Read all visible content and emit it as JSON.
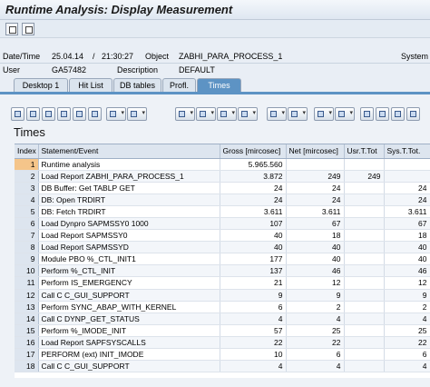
{
  "window": {
    "title": "Runtime Analysis: Display Measurement"
  },
  "header": {
    "date_label": "Date/Time",
    "date_value": "25.04.14",
    "sep": "/",
    "time_value": "21:30:27",
    "object_label": "Object",
    "object_value": "ZABHI_PARA_PROCESS_1",
    "system_label": "System",
    "user_label": "User",
    "user_value": "GA57482",
    "description_label": "Description",
    "description_value": "DEFAULT"
  },
  "tabs": [
    {
      "label": "Desktop 1"
    },
    {
      "label": "Hit List"
    },
    {
      "label": "DB tables"
    },
    {
      "label": "Profl."
    },
    {
      "label": "Times"
    }
  ],
  "active_tab": "Times",
  "section_heading": "Times",
  "table": {
    "columns": [
      "Index",
      "Statement/Event",
      "Gross [mircosec]",
      "Net [mircosec]",
      "Usr.T.Tot",
      "Sys.T.Tot."
    ],
    "rows": [
      [
        "1",
        "Runtime analysis",
        "5.965.560",
        "",
        "",
        ""
      ],
      [
        "2",
        "Load Report ZABHI_PARA_PROCESS_1",
        "3.872",
        "249",
        "249",
        ""
      ],
      [
        "3",
        "DB Buffer: Get TABLP GET",
        "24",
        "24",
        "",
        "24"
      ],
      [
        "4",
        "DB: Open TRDIRT",
        "24",
        "24",
        "",
        "24"
      ],
      [
        "5",
        "DB: Fetch TRDIRT",
        "3.611",
        "3.611",
        "",
        "3.611"
      ],
      [
        "6",
        "Load Dynpro SAPMSSY0 1000",
        "107",
        "67",
        "",
        "67"
      ],
      [
        "7",
        "Load Report SAPMSSY0",
        "40",
        "18",
        "",
        "18"
      ],
      [
        "8",
        "Load Report SAPMSSYD",
        "40",
        "40",
        "",
        "40"
      ],
      [
        "9",
        "Module PBO %_CTL_INIT1",
        "177",
        "40",
        "",
        "40"
      ],
      [
        "10",
        "Perform %_CTL_INIT",
        "137",
        "46",
        "",
        "46"
      ],
      [
        "11",
        "Perform IS_EMERGENCY",
        "21",
        "12",
        "",
        "12"
      ],
      [
        "12",
        "Call C C_GUI_SUPPORT",
        "9",
        "9",
        "",
        "9"
      ],
      [
        "13",
        "Perform SYNC_ABAP_WITH_KERNEL",
        "6",
        "2",
        "",
        "2"
      ],
      [
        "14",
        "Call C DYNP_GET_STATUS",
        "4",
        "4",
        "",
        "4"
      ],
      [
        "15",
        "Perform %_IMODE_INIT",
        "57",
        "25",
        "",
        "25"
      ],
      [
        "16",
        "Load Report SAPFSYSCALLS",
        "22",
        "22",
        "",
        "22"
      ],
      [
        "17",
        "PERFORM (ext) INIT_IMODE",
        "10",
        "6",
        "",
        "6"
      ],
      [
        "18",
        "Call C C_GUI_SUPPORT",
        "4",
        "4",
        "",
        "4"
      ]
    ]
  }
}
